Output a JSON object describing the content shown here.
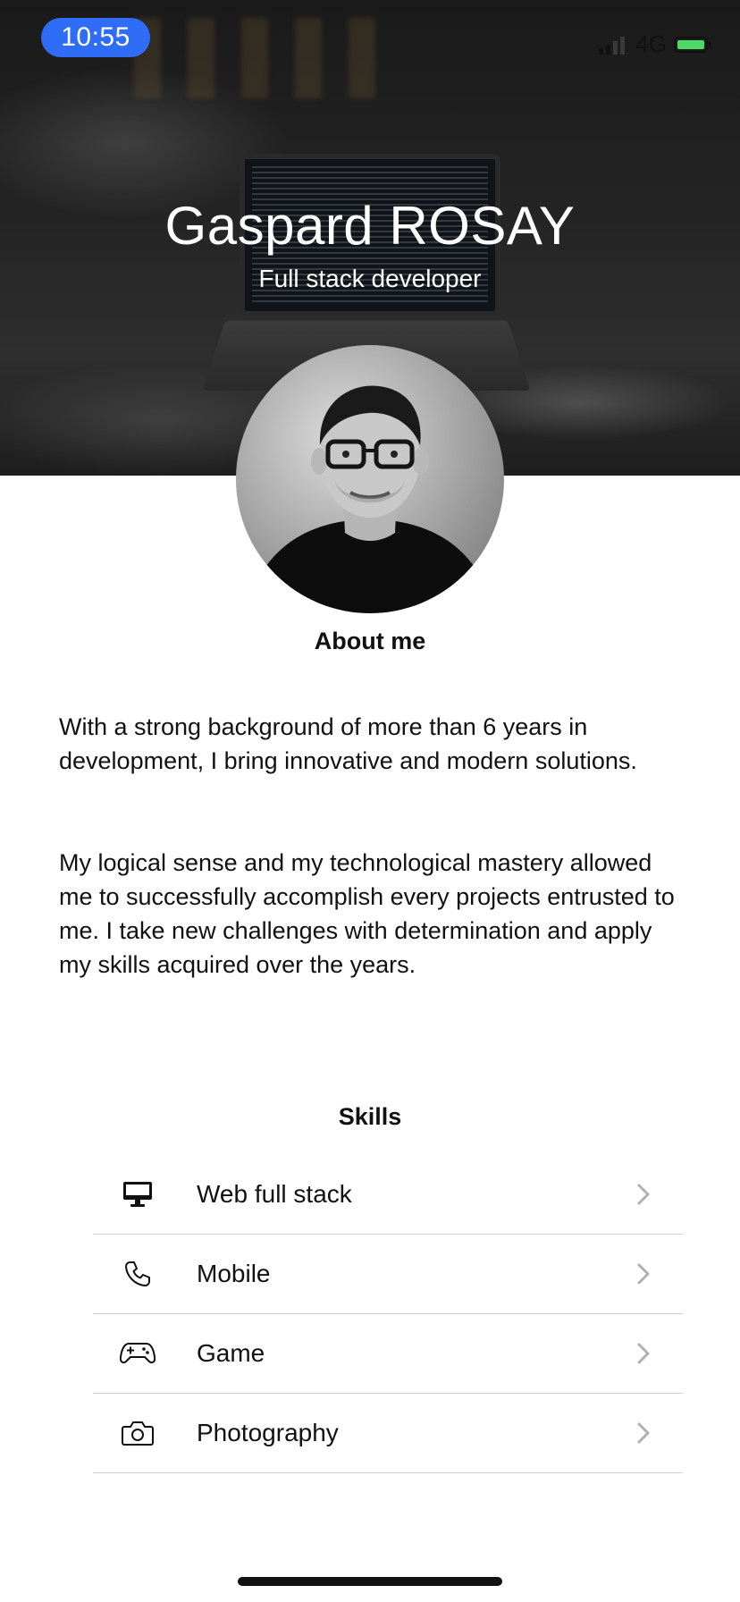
{
  "status_bar": {
    "time": "10:55",
    "network": "4G",
    "battery_color": "#4cd964",
    "time_bg_color": "#2f6df6"
  },
  "hero": {
    "name": "Gaspard ROSAY",
    "role": "Full stack developer"
  },
  "about": {
    "title": "About me",
    "paragraphs": [
      "With a strong background of more than 6 years in development, I bring innovative and modern solutions.",
      "My logical sense and my technological mastery allowed me to successfully accomplish every projects entrusted to me. I take new challenges with determination and apply my skills acquired over the years."
    ]
  },
  "skills": {
    "title": "Skills",
    "items": [
      {
        "label": "Web full stack",
        "icon": "desktop-icon"
      },
      {
        "label": "Mobile",
        "icon": "phone-icon"
      },
      {
        "label": "Game",
        "icon": "gamepad-icon"
      },
      {
        "label": "Photography",
        "icon": "camera-icon"
      }
    ]
  }
}
